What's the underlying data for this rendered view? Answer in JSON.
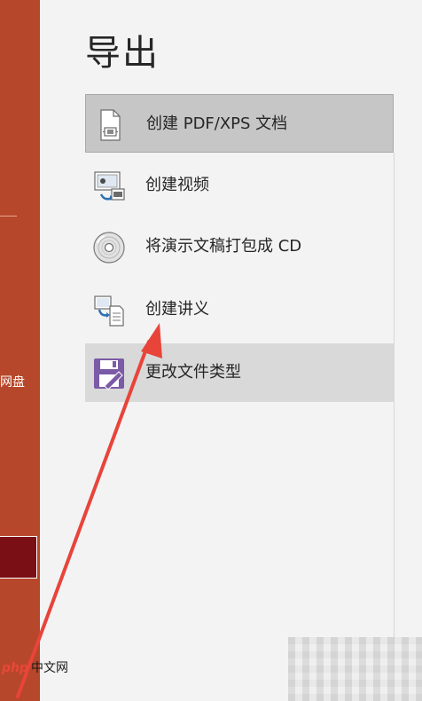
{
  "sidebar": {
    "label_partial": "网盘",
    "accent_color": "#b7472a"
  },
  "page": {
    "title": "导出"
  },
  "options": [
    {
      "label": "创建 PDF/XPS 文档",
      "icon": "pdf-document-icon",
      "selected": true
    },
    {
      "label": "创建视频",
      "icon": "video-icon"
    },
    {
      "label": "将演示文稿打包成 CD",
      "icon": "cd-icon"
    },
    {
      "label": "创建讲义",
      "icon": "handout-icon"
    },
    {
      "label": "更改文件类型",
      "icon": "floppy-save-icon",
      "highlighted": true
    }
  ],
  "watermark": {
    "brand": "php",
    "text": "中文网"
  }
}
